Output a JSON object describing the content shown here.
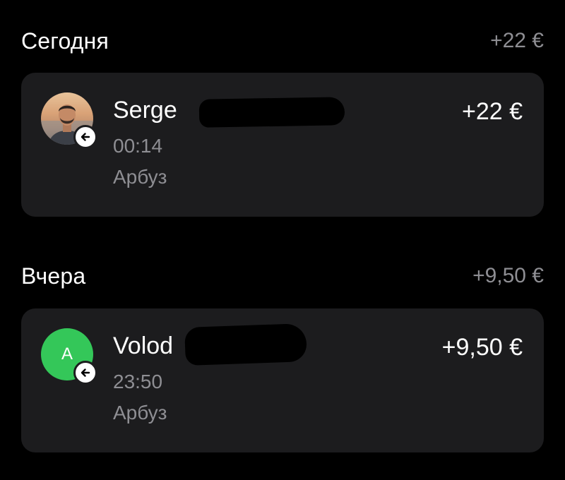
{
  "sections": [
    {
      "title": "Сегодня",
      "total": "+22 €",
      "transactions": [
        {
          "name": "Serge",
          "time": "00:14",
          "merchant": "Арбуз",
          "amount": "+22 €",
          "avatar_type": "photo",
          "direction_icon": "incoming-arrow-icon"
        }
      ]
    },
    {
      "title": "Вчера",
      "total": "+9,50 €",
      "transactions": [
        {
          "name": "Volod",
          "time": "23:50",
          "merchant": "Арбуз",
          "amount": "+9,50 €",
          "avatar_type": "letter",
          "avatar_letter": "A",
          "avatar_color": "#34c759",
          "direction_icon": "incoming-arrow-icon"
        }
      ]
    }
  ],
  "colors": {
    "background": "#000000",
    "card": "#1c1c1e",
    "secondary_text": "#8e8e93",
    "accent_green": "#34c759"
  }
}
